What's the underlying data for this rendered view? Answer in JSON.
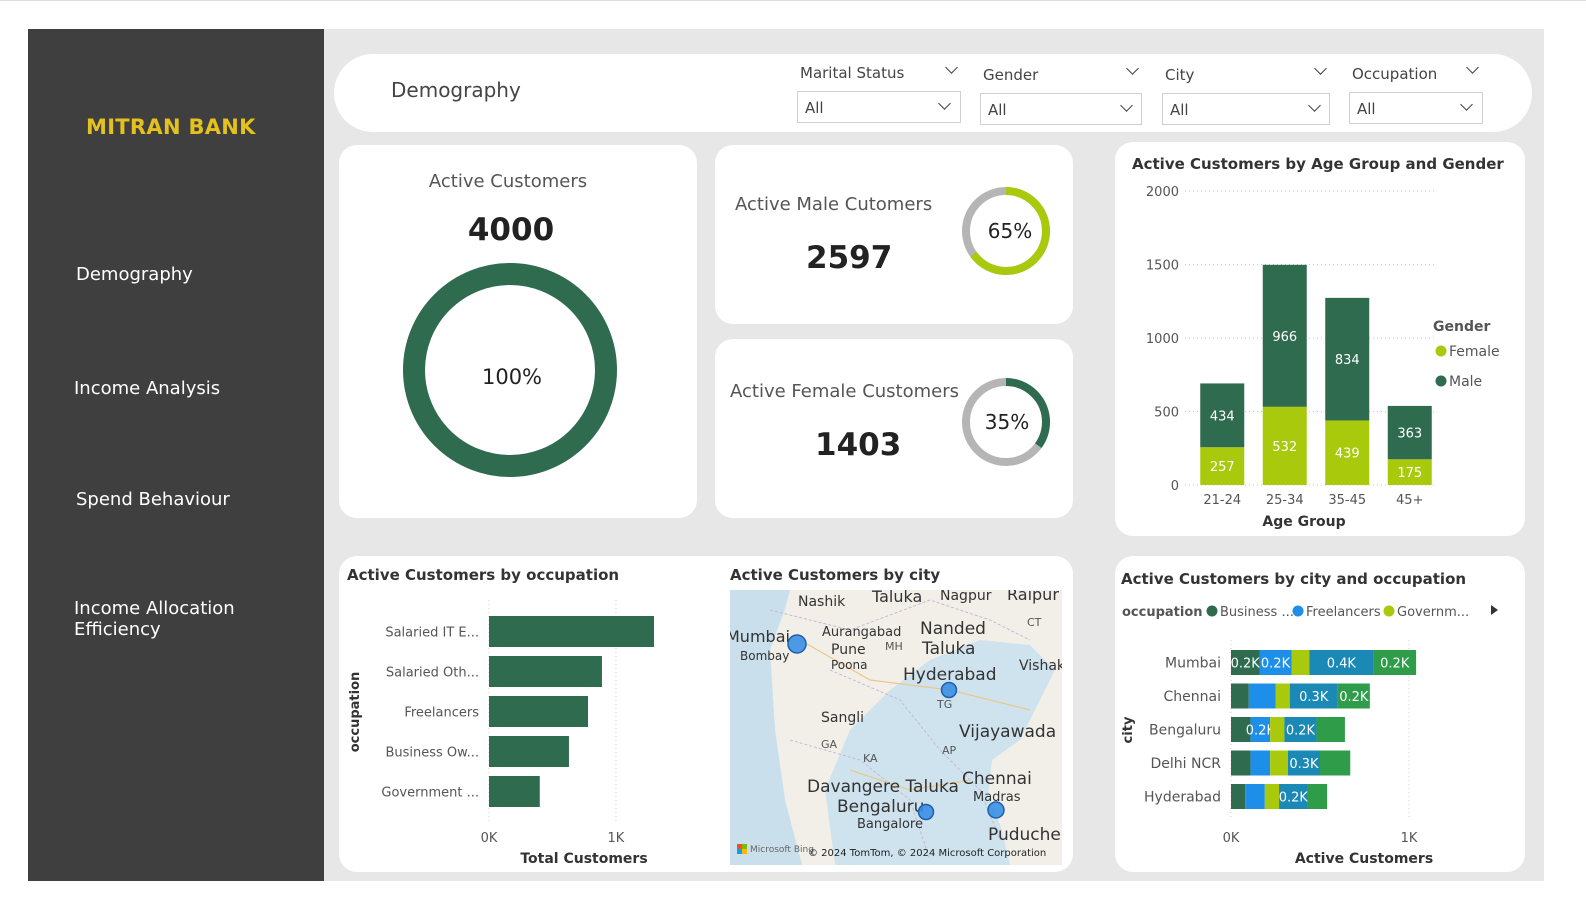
{
  "app": {
    "brand": "MITRAN BANK",
    "page_title": "Demography"
  },
  "nav": {
    "items": [
      {
        "label": "Demography"
      },
      {
        "label": "Income Analysis"
      },
      {
        "label": "Spend Behaviour"
      },
      {
        "label": "Income Allocation Efficiency"
      }
    ]
  },
  "filters": [
    {
      "label": "Marital Status",
      "value": "All"
    },
    {
      "label": "Gender",
      "value": "All"
    },
    {
      "label": "City",
      "value": "All"
    },
    {
      "label": "Occupation",
      "value": "All"
    }
  ],
  "kpis": {
    "active": {
      "title": "Active Customers",
      "value": "4000",
      "pct_label": "100%",
      "pct": 1.0
    },
    "male": {
      "title": "Active Male Cutomers",
      "value": "2597",
      "pct_label": "65%",
      "pct": 0.65
    },
    "female": {
      "title": "Active Female Customers",
      "value": "1403",
      "pct_label": "35%",
      "pct": 0.35
    }
  },
  "colors": {
    "male": "#2e6b4f",
    "female": "#a9c90d",
    "business": "#2e6b4f",
    "freelancers": "#1e8fe8",
    "government": "#a9c90d",
    "dark_blue": "#1a89b5",
    "green": "#2f9c4a",
    "sidebar": "#3f3f3f",
    "brand": "#e5c11f"
  },
  "chart_data": [
    {
      "type": "bar",
      "title": "Active Customers by Age Group and Gender",
      "xlabel": "Age Group",
      "ylabel": "",
      "categories": [
        "21-24",
        "25-34",
        "35-45",
        "45+"
      ],
      "series": [
        {
          "name": "Female",
          "values": [
            257,
            532,
            439,
            175
          ]
        },
        {
          "name": "Male",
          "values": [
            434,
            966,
            834,
            363
          ]
        }
      ],
      "ylim": [
        0,
        2000
      ],
      "yticks": [
        "0",
        "500",
        "1000",
        "1500",
        "2000"
      ],
      "legend_title": "Gender",
      "legend_position": "right",
      "stacked": true
    },
    {
      "type": "bar",
      "orientation": "horizontal",
      "title": "Active Customers by occupation",
      "xlabel": "Total Customers",
      "ylabel": "occupation",
      "categories": [
        "Salaried IT E...",
        "Salaried Oth...",
        "Freelancers",
        "Business Ow...",
        "Government ..."
      ],
      "values": [
        1300,
        890,
        780,
        630,
        400
      ],
      "xlim": [
        0,
        1300
      ],
      "xticks": [
        "0K",
        "1K"
      ]
    },
    {
      "type": "bar",
      "orientation": "horizontal",
      "stacked": true,
      "title": "Active Customers by city and occupation",
      "xlabel": "Active Customers",
      "ylabel": "city",
      "legend_title": "occupation",
      "legend": [
        "Business ...",
        "Freelancers",
        "Governm..."
      ],
      "categories": [
        "Mumbai",
        "Chennai",
        "Bengaluru",
        "Delhi NCR",
        "Hyderabad"
      ],
      "segment_colors": [
        "#2e6b4f",
        "#1e8fe8",
        "#a9c90d",
        "#1a89b5",
        "#2f9c4a"
      ],
      "series": [
        {
          "values": [
            160,
            100,
            110,
            110,
            80
          ],
          "labels": [
            "0.2K",
            "",
            "",
            "",
            ""
          ]
        },
        {
          "values": [
            180,
            150,
            110,
            110,
            110
          ],
          "labels": [
            "0.2K",
            "",
            "0.2K",
            "",
            ""
          ]
        },
        {
          "values": [
            100,
            80,
            80,
            100,
            80
          ],
          "labels": [
            "",
            "",
            "",
            "",
            ""
          ]
        },
        {
          "values": [
            360,
            270,
            180,
            180,
            160
          ],
          "labels": [
            "0.4K",
            "0.3K",
            "0.2K",
            "0.3K",
            "0.2K"
          ]
        },
        {
          "values": [
            240,
            180,
            160,
            170,
            110
          ],
          "labels": [
            "0.2K",
            "0.2K",
            "",
            "",
            ""
          ]
        }
      ],
      "xlim": [
        0,
        1000
      ],
      "xticks": [
        "0K",
        "1K"
      ]
    }
  ],
  "map": {
    "title": "Active Customers by city",
    "labels": [
      "Nashik",
      "Taluka",
      "Nagpur",
      "Raipur",
      "Mumbai",
      "Bombay",
      "Aurangabad",
      "Nanded",
      "Taluka",
      "Pune",
      "Poona",
      "MH",
      "CT",
      "Vishak",
      "Hyderabad",
      "TG",
      "Sangli",
      "Vijayawada",
      "GA",
      "AP",
      "KA",
      "Davangere Taluka",
      "Chennai",
      "Bengaluru",
      "Bangalore",
      "Madras",
      "Puducher"
    ],
    "attribution": "© 2024 TomTom, © 2024 Microsoft Corporation",
    "brand": "Microsoft Bing"
  }
}
